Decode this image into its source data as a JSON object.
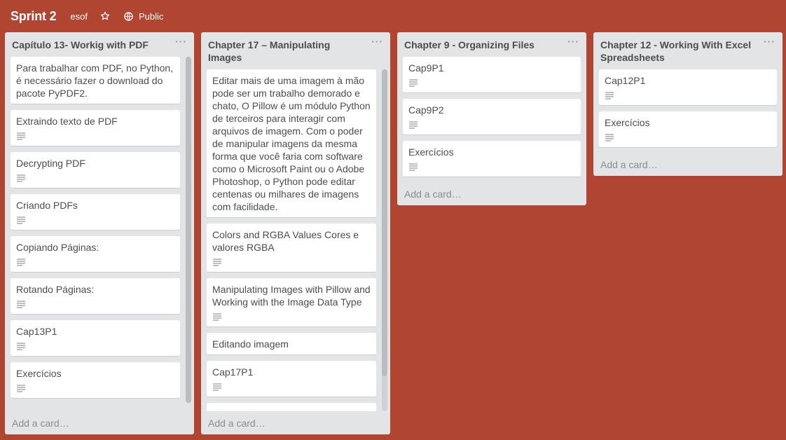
{
  "board": {
    "title": "Sprint 2",
    "team": "esof",
    "visibility": "Public"
  },
  "colors": {
    "background": "#b04632",
    "list_bg": "#e2e4e6",
    "card_bg": "#ffffff"
  },
  "lists": [
    {
      "title": "Capítulo 13- Workig with PDF",
      "add_card": "Add a card…",
      "cards": [
        "Para trabalhar com PDF, no Python, é necessário fazer o download do pacote PyPDF2.",
        "Extraindo texto de PDF",
        "Decrypting PDF",
        "Criando PDFs",
        "Copiando Páginas:",
        "Rotando Páginas:",
        "Cap13P1",
        "Exercícios"
      ]
    },
    {
      "title": "Chapter 17 – Manipulating Images",
      "add_card": "Add a card…",
      "cards": [
        "Editar mais de uma imagem à mão pode ser um trabalho demorado e chato, O Pillow é um módulo Python de terceiros para interagir com arquivos de imagem. Com o poder de manipular imagens da mesma forma que você faria com software como o Microsoft Paint ou o Adobe Photoshop, o Python pode editar centenas ou milhares de imagens com facilidade.",
        "Colors and RGBA Values Cores e valores RGBA",
        "Manipulating Images with Pillow and Working with the Image Data Type",
        "Editando imagem",
        "Cap17P1"
      ]
    },
    {
      "title": "Chapter 9 - Organizing Files",
      "add_card": "Add a card…",
      "cards": [
        "Cap9P1",
        "Cap9P2",
        "Exercícios"
      ]
    },
    {
      "title": "Chapter 12 - Working With Excel Spreadsheets",
      "add_card": "Add a card…",
      "cards": [
        "Cap12P1",
        "Exercícios"
      ]
    }
  ],
  "list_menu": "···"
}
